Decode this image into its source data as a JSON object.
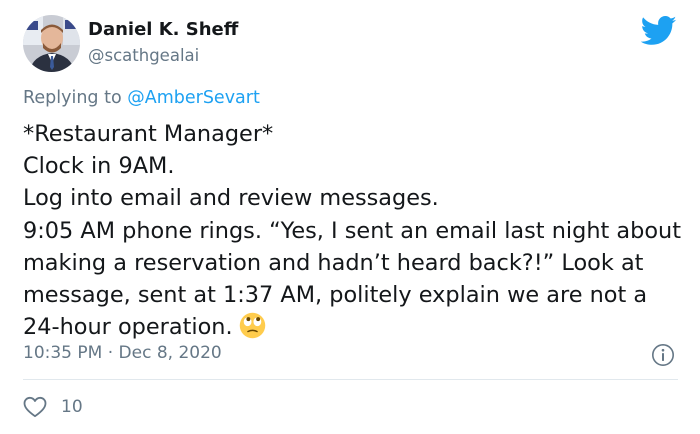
{
  "author": {
    "name": "Daniel K. Sheff",
    "handle": "@scathgealai"
  },
  "reply": {
    "prefix": "Replying to ",
    "mention": "@AmberSevart"
  },
  "tweet": {
    "text": "*Restaurant Manager*\nClock in 9AM.\nLog into email and review messages.\n9:05 AM phone rings. “Yes, I sent an email last night about making a reservation and hadn’t heard back?!” Look at message, sent at 1:37 AM, politely explain we are not a 24-hour operation.",
    "emoji": "face-with-rolling-eyes"
  },
  "meta": {
    "timestamp": "10:35 PM · Dec 8, 2020"
  },
  "actions": {
    "likes": "10"
  },
  "icons": {
    "brand": "twitter-bird-icon",
    "info": "info-icon",
    "like": "heart-icon"
  },
  "colors": {
    "brand": "#1da1f2",
    "text": "#14171a",
    "secondary": "#657786",
    "divider": "#e1e8ed"
  }
}
